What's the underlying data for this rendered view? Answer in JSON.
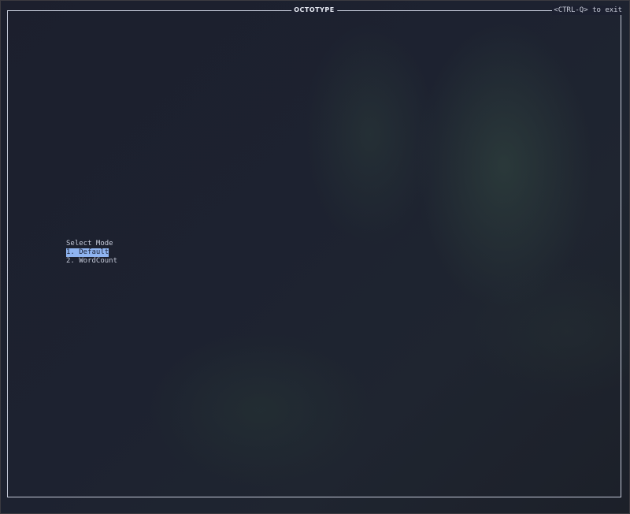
{
  "window": {
    "title": "OCTOTYPE",
    "exit_hint": "<CTRL-Q> to exit"
  },
  "menu": {
    "heading": "Select Mode",
    "items": [
      {
        "label": "1. Default",
        "selected": true
      },
      {
        "label": "2. WordCount",
        "selected": false
      }
    ]
  },
  "colors": {
    "background": "#1d2230",
    "border": "#c2c7d6",
    "text": "#c4c9d8",
    "selection_bg": "#8fb4f0",
    "selection_fg": "#1b2236"
  }
}
